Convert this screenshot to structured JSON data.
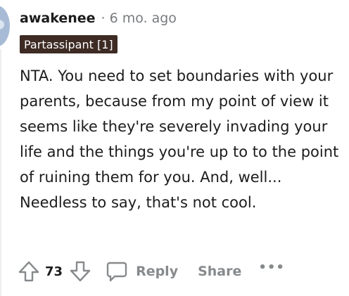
{
  "comment": {
    "author": "awakenee",
    "separator": "·",
    "time_ago": "6 mo. ago",
    "flair": "Partassipant [1]",
    "body": "NTA. You need to set boundaries with your parents, because from my point of view it seems like they're severely invading your life and the things you're up to to the point of ruining them for you. And, well... Needless to say, that's not cool."
  },
  "actions": {
    "upvote_icon": "upvote-arrow-icon",
    "vote_count": "73",
    "downvote_icon": "downvote-arrow-icon",
    "reply_icon": "comment-bubble-icon",
    "reply_label": "Reply",
    "share_label": "Share",
    "more_label": "•••"
  },
  "colors": {
    "text": "#1c1c1c",
    "muted": "#787c7e",
    "action_gray": "#878a8c",
    "flair_bg": "#3d2b24",
    "flair_text": "#ffffff"
  }
}
